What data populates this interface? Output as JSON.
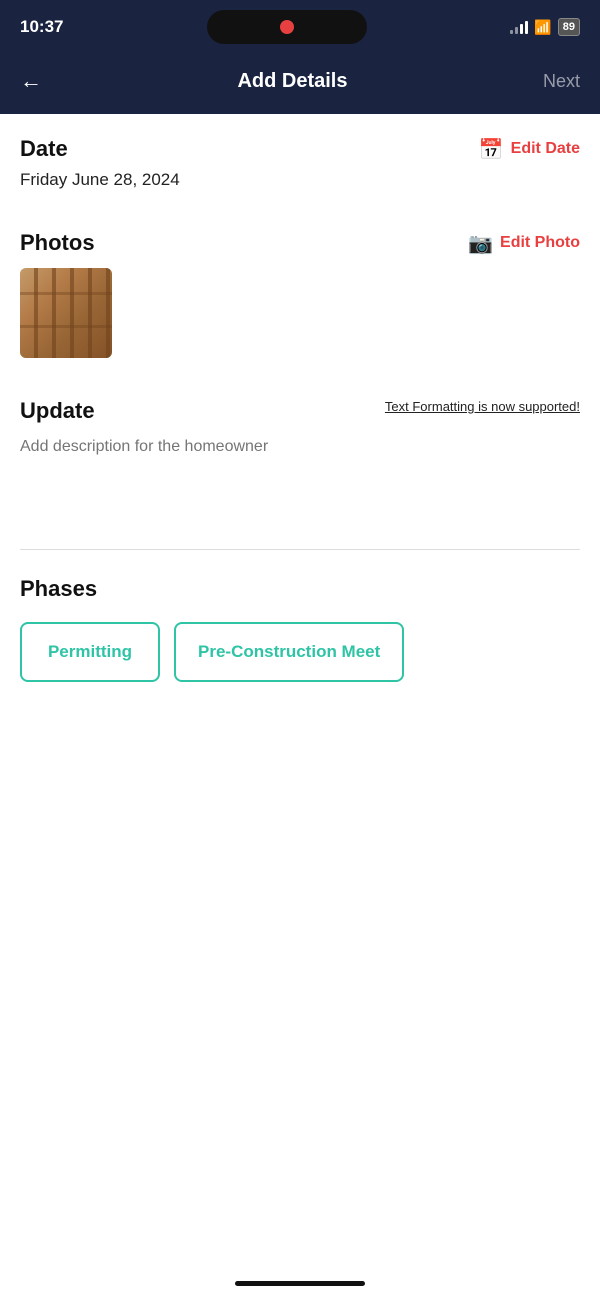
{
  "statusBar": {
    "time": "10:37",
    "battery": "89"
  },
  "navBar": {
    "backLabel": "←",
    "title": "Add Details",
    "nextLabel": "Next"
  },
  "dateSectionTitle": "Date",
  "editDateLabel": "Edit Date",
  "dateValue": "Friday June 28, 2024",
  "photosSectionTitle": "Photos",
  "editPhotoLabel": "Edit Photo",
  "updateSectionTitle": "Update",
  "formattingLinkText": "Text Formatting is now supported!",
  "descriptionPlaceholder": "Add description for the homeowner",
  "phasesSectionTitle": "Phases",
  "phases": [
    {
      "label": "Permitting"
    },
    {
      "label": "Pre-Construction Meet"
    }
  ],
  "colors": {
    "accent": "#e84040",
    "teal": "#2ec4a5",
    "navBg": "#1a2340",
    "textDark": "#111",
    "textMuted": "#bbb"
  }
}
